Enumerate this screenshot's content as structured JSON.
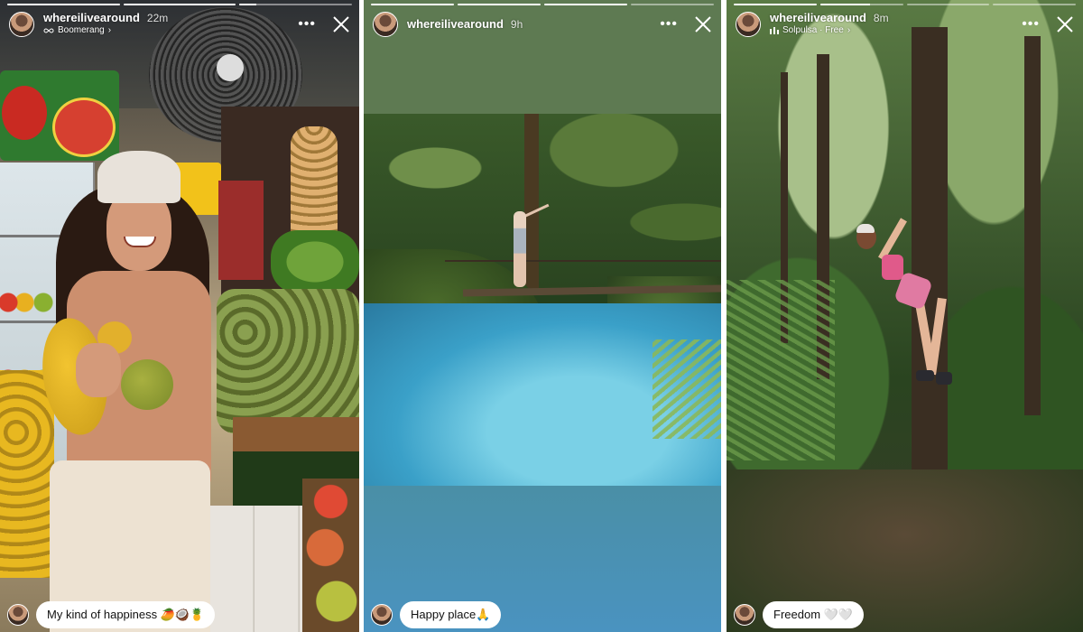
{
  "stories": [
    {
      "username": "whereilivearound",
      "time": "22m",
      "subtitle": "Boomerang",
      "subtitle_icon": "infinity-icon",
      "subtitle_chevron": "›",
      "caption": "My kind of happiness 🥭🥥🍍",
      "progress": [
        1.0,
        1.0,
        0.15
      ]
    },
    {
      "username": "whereilivearound",
      "time": "9h",
      "caption": "Happy place🙏",
      "progress": [
        1.0,
        1.0,
        1.0,
        0.0
      ]
    },
    {
      "username": "whereilivearound",
      "time": "8m",
      "subtitle": "Solpulsa · Free",
      "subtitle_icon": "music-bars-icon",
      "subtitle_chevron": "›",
      "caption": "Freedom 🤍🤍",
      "progress": [
        1.0,
        0.6,
        0.0,
        0.0
      ]
    }
  ],
  "icons": {
    "more": "•••",
    "close": "close-icon"
  },
  "colors": {
    "story2_top": "#5e7a52",
    "story2_bottom": "#4a93c0"
  }
}
